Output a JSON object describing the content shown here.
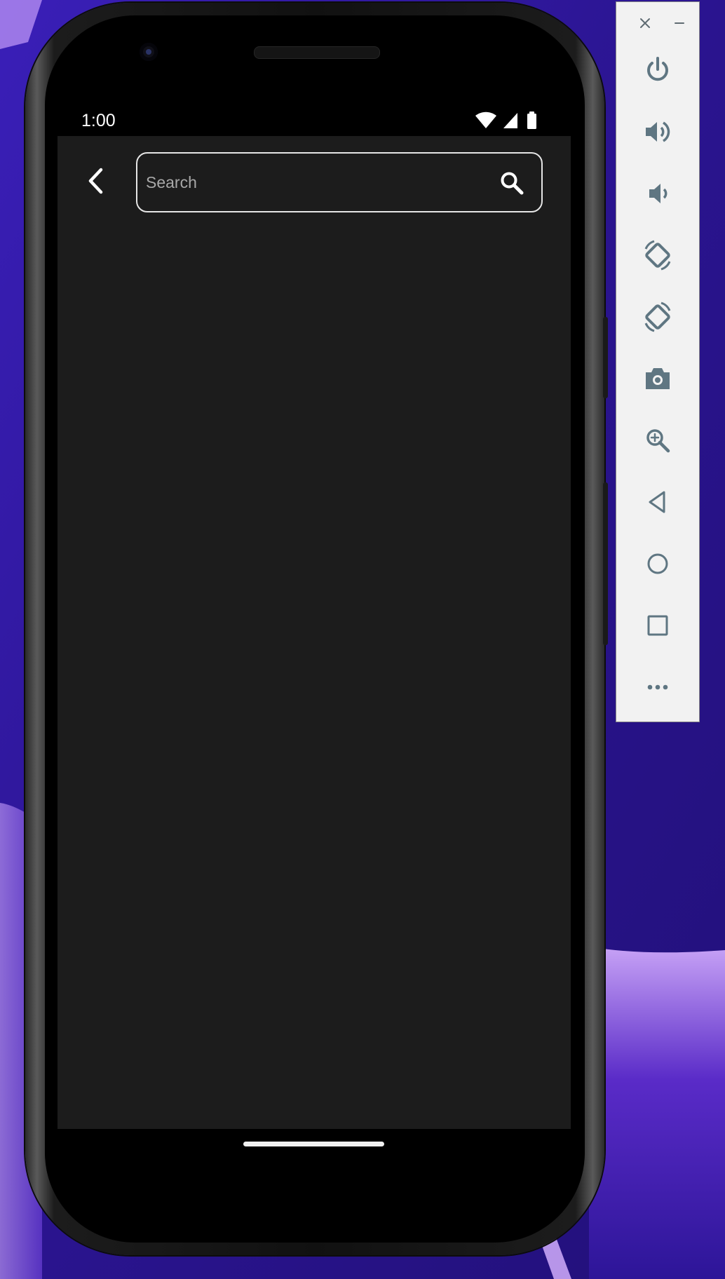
{
  "status_bar": {
    "time": "1:00",
    "icons": [
      "wifi-icon",
      "cellular-signal-icon",
      "battery-icon"
    ]
  },
  "search": {
    "placeholder": "Search",
    "value": ""
  },
  "icons": {
    "back": "chevron-left-icon",
    "search": "search-icon"
  },
  "emulator_toolbar": {
    "window_controls": [
      "close-icon",
      "minimize-icon"
    ],
    "buttons": [
      "power-icon",
      "volume-up-icon",
      "volume-down-icon",
      "rotate-left-icon",
      "rotate-right-icon",
      "camera-icon",
      "zoom-icon",
      "back-triangle-icon",
      "home-circle-icon",
      "overview-square-icon",
      "more-icon"
    ]
  },
  "colors": {
    "wallpaper": "#2a148f",
    "app_background": "#1c1c1c",
    "toolbar_icon": "#5f7682",
    "toolbar_background": "#f2f2f2",
    "search_border": "#e6e6e6",
    "placeholder_text": "#a8a8a8"
  }
}
